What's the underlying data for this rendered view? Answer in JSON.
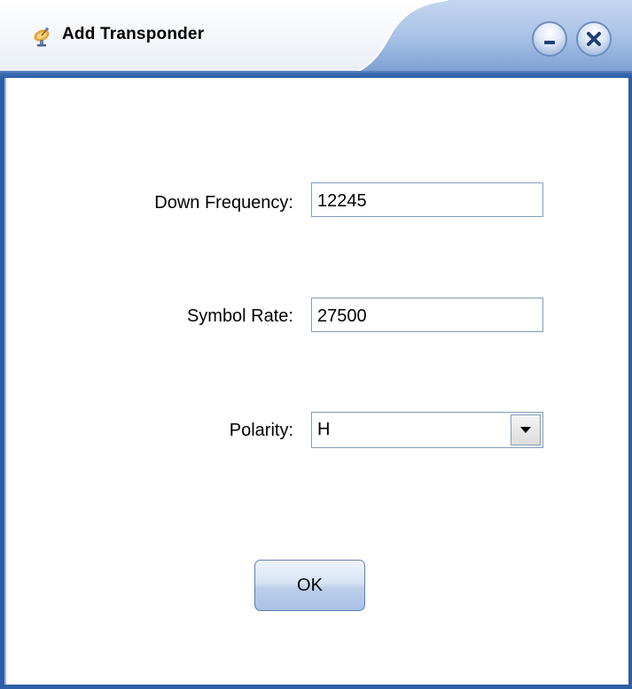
{
  "window": {
    "title": "Add  Transponder",
    "title_icon": "satellite-dish-icon",
    "minimize_icon": "minimize-icon",
    "close_icon": "close-icon"
  },
  "form": {
    "down_frequency": {
      "label": "Down Frequency:",
      "value": "12245"
    },
    "symbol_rate": {
      "label": "Symbol Rate:",
      "value": "27500"
    },
    "polarity": {
      "label": "Polarity:",
      "selected": "H",
      "arrow_icon": "chevron-down-icon"
    }
  },
  "buttons": {
    "ok_label": "OK"
  },
  "colors": {
    "frame_blue": "#2d5ea6",
    "input_border": "#7f9db9",
    "button_blue": "#bccfeb"
  }
}
